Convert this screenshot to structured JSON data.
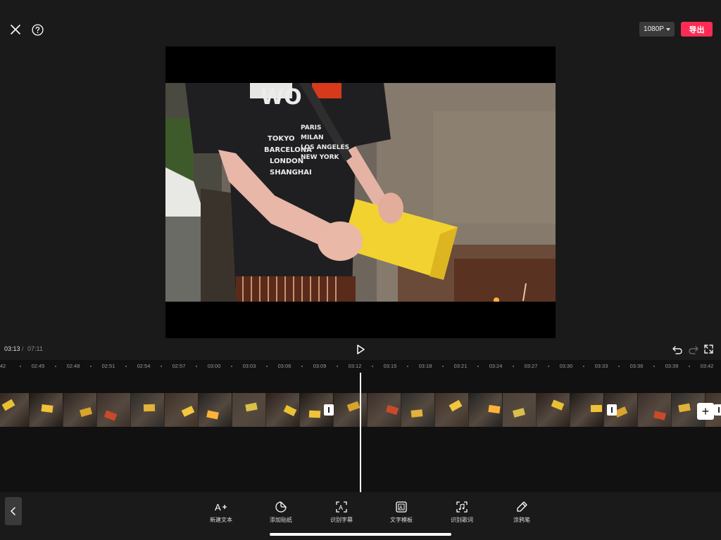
{
  "header": {
    "close_icon": "close-icon",
    "help_icon": "help-icon",
    "resolution_label": "1080P",
    "export_label": "导出",
    "export_color": "#fe2c55"
  },
  "playback": {
    "current_time": "03:13",
    "separator": "/",
    "total_time": "07:11",
    "play_icon": "play-icon",
    "undo_icon": "undo-icon",
    "redo_icon": "redo-icon",
    "fullscreen_icon": "fullscreen-icon"
  },
  "timeline": {
    "ruler_labels": [
      "42",
      "02:45",
      "02:48",
      "02:51",
      "02:54",
      "02:57",
      "03:00",
      "03:03",
      "03:06",
      "03:09",
      "03:12",
      "03:15",
      "03:18",
      "03:21",
      "03:24",
      "03:27",
      "03:30",
      "03:33",
      "03:36",
      "03:39",
      "03:42"
    ],
    "add_clip_icon": "plus-icon"
  },
  "toolbar": {
    "back_icon": "chevron-left-icon",
    "items": [
      {
        "label": "新建文本",
        "icon": "add-text-icon"
      },
      {
        "label": "添加贴纸",
        "icon": "sticker-icon"
      },
      {
        "label": "识别字幕",
        "icon": "recognize-subtitles-icon"
      },
      {
        "label": "文字模板",
        "icon": "text-template-icon"
      },
      {
        "label": "识别歌词",
        "icon": "recognize-lyrics-icon"
      },
      {
        "label": "涂鸦笔",
        "icon": "brush-icon"
      }
    ]
  },
  "video_frame": {
    "shirt_text": [
      "TOKYO",
      "BARCELONA",
      "LONDON",
      "SHANGHAI",
      "PARIS",
      "MILAN",
      "LOS ANGELES",
      "NEW YORK"
    ]
  }
}
